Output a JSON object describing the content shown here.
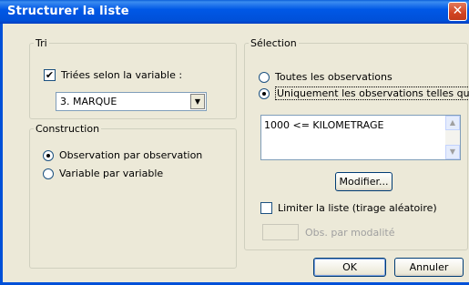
{
  "window": {
    "title": "Structurer la liste",
    "close_icon": "✕"
  },
  "tri": {
    "legend": "Tri",
    "checkbox_label": "Triées selon la variable :",
    "checked": true,
    "select_value": "3. MARQUE"
  },
  "construction": {
    "legend": "Construction",
    "options": [
      {
        "label": "Observation par observation",
        "selected": true
      },
      {
        "label": "Variable par variable",
        "selected": false
      }
    ]
  },
  "selection": {
    "legend": "Sélection",
    "options": [
      {
        "label": "Toutes les observations",
        "selected": false
      },
      {
        "label": "Uniquement les observations telles que ...",
        "selected": true
      }
    ],
    "condition_text": "1000 <= KILOMETRAGE",
    "modify_button": "Modifier...",
    "limit_label": "Limiter la liste (tirage aléatoire)",
    "limit_checked": false,
    "obs_label": "Obs. par modalité",
    "obs_value": ""
  },
  "buttons": {
    "ok": "OK",
    "cancel": "Annuler"
  }
}
